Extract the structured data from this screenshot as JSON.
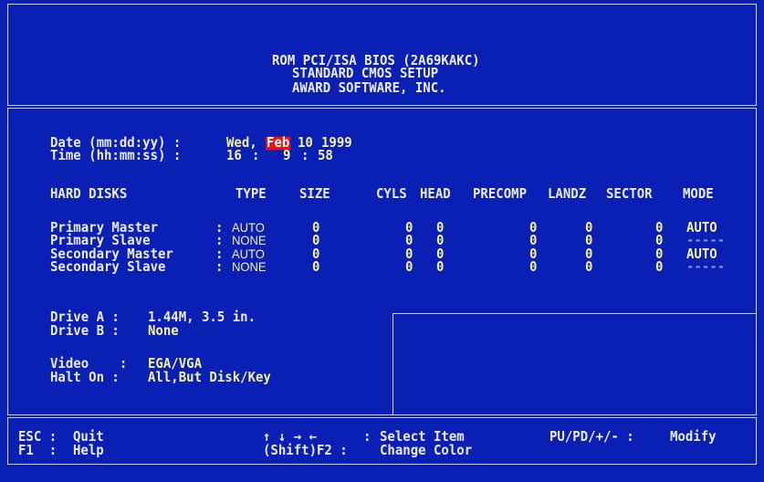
{
  "header": {
    "line1": "ROM PCI/ISA BIOS (2A69KAKC)",
    "line2": "STANDARD CMOS SETUP",
    "line3": "AWARD SOFTWARE, INC."
  },
  "date": {
    "label": "Date (mm:dd:yy) :",
    "weekday": "Wed,",
    "month": "Feb",
    "day": "10",
    "year": "1999"
  },
  "time": {
    "label": "Time (hh:mm:ss) :",
    "hh": "16",
    "sep1": ":",
    "mm": "9",
    "sep2": ":",
    "ss": "58"
  },
  "disks": {
    "headers": {
      "name": "HARD DISKS",
      "type": "TYPE",
      "size": "SIZE",
      "cyls": "CYLS",
      "head": "HEAD",
      "precomp": "PRECOMP",
      "landz": "LANDZ",
      "sector": "SECTOR",
      "mode": "MODE"
    },
    "rows": [
      {
        "name": "Primary Master",
        "sep": ":",
        "type": "AUTO",
        "size": "0",
        "cyls": "0",
        "head": "0",
        "precomp": "0",
        "landz": "0",
        "sector": "0",
        "mode": "AUTO"
      },
      {
        "name": "Primary Slave",
        "sep": ":",
        "type": "NONE",
        "size": "0",
        "cyls": "0",
        "head": "0",
        "precomp": "0",
        "landz": "0",
        "sector": "0",
        "mode": "-----"
      },
      {
        "name": "Secondary Master",
        "sep": ":",
        "type": "AUTO",
        "size": "0",
        "cyls": "0",
        "head": "0",
        "precomp": "0",
        "landz": "0",
        "sector": "0",
        "mode": "AUTO"
      },
      {
        "name": "Secondary Slave",
        "sep": ":",
        "type": "NONE",
        "size": "0",
        "cyls": "0",
        "head": "0",
        "precomp": "0",
        "landz": "0",
        "sector": "0",
        "mode": "-----"
      }
    ]
  },
  "drives": {
    "a_label": "Drive A :",
    "a_value": "1.44M, 3.5 in.",
    "b_label": "Drive B :",
    "b_value": "None"
  },
  "video": {
    "label": "Video    :",
    "value": "EGA/VGA"
  },
  "halt": {
    "label": "Halt On :",
    "value": "All,But Disk/Key"
  },
  "footer": {
    "esc_key": "ESC :",
    "esc_label": "Quit",
    "f1_key": "F1  :",
    "f1_label": "Help",
    "arrows_key": "↑ ↓ → ←",
    "arrows_sep": ":",
    "arrows_label": "Select Item",
    "shiftf2_key": "(Shift)F2 :",
    "shiftf2_label": "Change Color",
    "modify_key": "PU/PD/+/- :",
    "modify_label": "Modify"
  },
  "colors": {
    "background": "#0a1fb4",
    "text": "#ececf0",
    "value_yellow": "#f2f2a0",
    "selection": "#e81010"
  }
}
